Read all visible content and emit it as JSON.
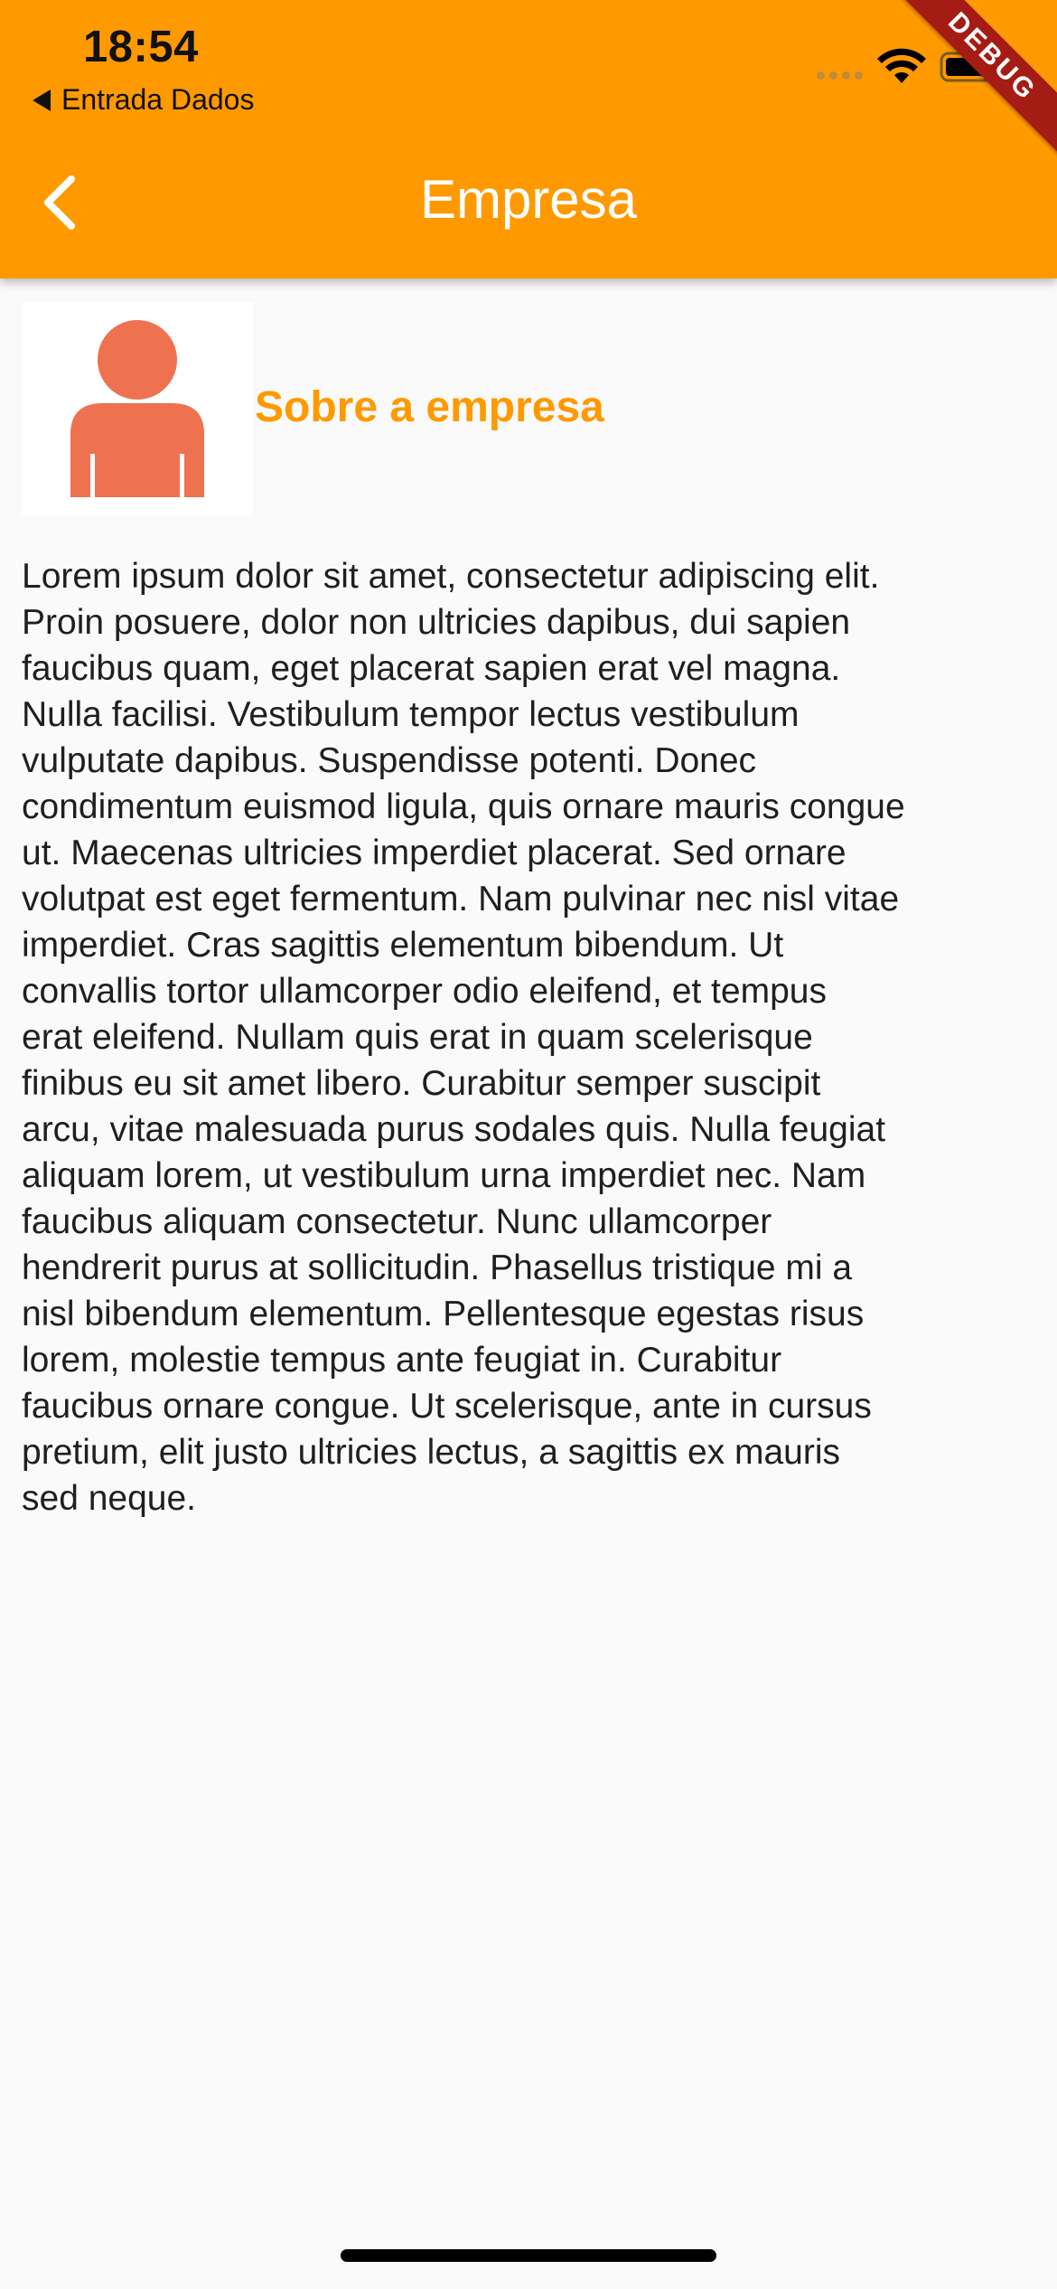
{
  "status_bar": {
    "time": "18:54",
    "back_app_label": "Entrada Dados"
  },
  "debug_banner": "DEBUG",
  "app_bar": {
    "title": "Empresa",
    "back_icon": "chevron-left-icon",
    "background_color": "#ff9900"
  },
  "about": {
    "title": "Sobre a empresa",
    "title_color": "#ff9900",
    "avatar_icon": "person-icon",
    "avatar_color": "#ee7150",
    "text_lines": [
      "Lorem ipsum dolor sit amet, consectetur adipiscing elit.",
      "Proin posuere, dolor non ultricies dapibus, dui sapien",
      "faucibus quam, eget placerat sapien erat vel magna.",
      "Nulla facilisi. Vestibulum tempor lectus vestibulum",
      "vulputate dapibus. Suspendisse potenti. Donec",
      "condimentum euismod ligula, quis ornare mauris congue",
      "ut. Maecenas ultricies imperdiet placerat. Sed ornare",
      "volutpat est eget fermentum. Nam pulvinar nec nisl vitae",
      "imperdiet. Cras sagittis elementum bibendum. Ut",
      "convallis tortor ullamcorper odio eleifend, et tempus",
      "erat eleifend. Nullam quis erat in quam scelerisque",
      "finibus eu sit amet libero. Curabitur semper suscipit",
      "arcu, vitae malesuada purus sodales quis. Nulla feugiat",
      "aliquam lorem, ut vestibulum urna imperdiet nec. Nam",
      "faucibus aliquam consectetur. Nunc ullamcorper",
      "hendrerit purus at sollicitudin. Phasellus tristique mi a",
      "nisl bibendum elementum. Pellentesque egestas risus",
      "lorem, molestie tempus ante feugiat in. Curabitur",
      "faucibus ornare congue. Ut scelerisque, ante in cursus",
      "pretium, elit justo ultricies lectus, a sagittis ex mauris",
      "sed neque."
    ]
  }
}
